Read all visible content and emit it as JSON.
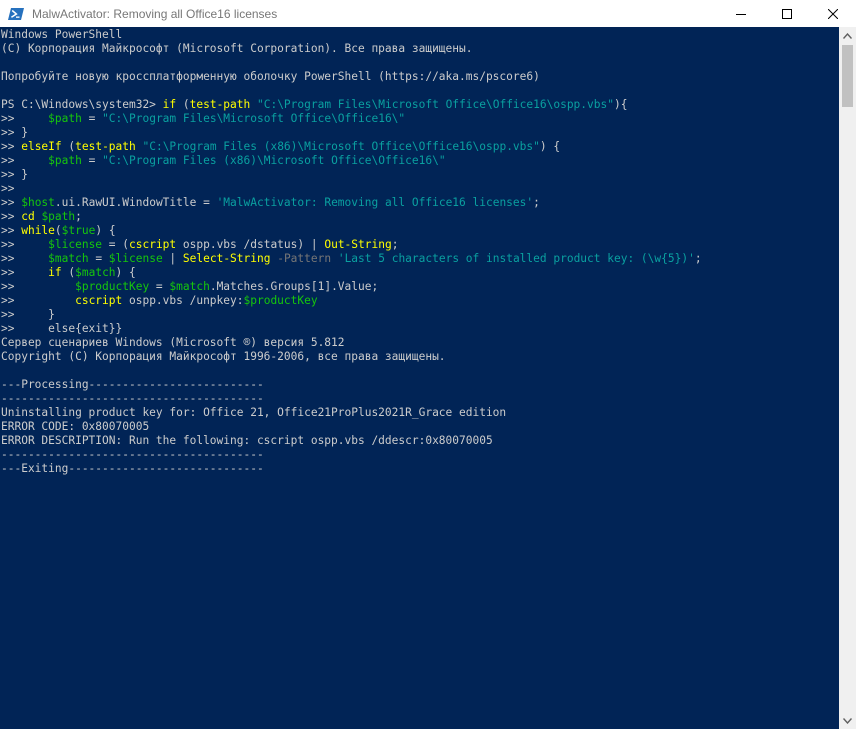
{
  "window": {
    "title": "MalwActivator: Removing all Office16 licenses",
    "controls": {
      "minimize": "minimize",
      "maximize": "maximize",
      "close": "close"
    }
  },
  "icons": {
    "app": "powershell-icon",
    "scroll_up": "chevron-up-icon",
    "scroll_down": "chevron-down-icon"
  },
  "colors": {
    "background": "#012456",
    "text": "#cccccc",
    "command": "#ffff00",
    "variable": "#13a10e",
    "string": "#0aa0a0",
    "operator": "#767676"
  },
  "console": {
    "lines": [
      [
        [
          "w",
          "Windows PowerShell"
        ]
      ],
      [
        [
          "w",
          "(C) Корпорация Майкрософт (Microsoft Corporation). Все права защищены."
        ]
      ],
      [
        [
          "w",
          ""
        ]
      ],
      [
        [
          "w",
          "Попробуйте новую кроссплатформенную оболочку PowerShell (https://aka.ms/pscore6)"
        ]
      ],
      [
        [
          "w",
          ""
        ]
      ],
      [
        [
          "w",
          "PS C:\\Windows\\system32> "
        ],
        [
          "y",
          "if "
        ],
        [
          "w",
          "("
        ],
        [
          "y",
          "test-path "
        ],
        [
          "s",
          "\"C:\\Program Files\\Microsoft Office\\Office16\\ospp.vbs\""
        ],
        [
          "w",
          "){"
        ]
      ],
      [
        [
          "w",
          ">>     "
        ],
        [
          "v",
          "$path"
        ],
        [
          "w",
          " = "
        ],
        [
          "s",
          "\"C:\\Program Files\\Microsoft Office\\Office16\\\""
        ]
      ],
      [
        [
          "w",
          ">> }"
        ]
      ],
      [
        [
          "w",
          ">> "
        ],
        [
          "y",
          "elseIf "
        ],
        [
          "w",
          "("
        ],
        [
          "y",
          "test-path "
        ],
        [
          "s",
          "\"C:\\Program Files (x86)\\Microsoft Office\\Office16\\ospp.vbs\""
        ],
        [
          "w",
          ") {"
        ]
      ],
      [
        [
          "w",
          ">>     "
        ],
        [
          "v",
          "$path"
        ],
        [
          "w",
          " = "
        ],
        [
          "s",
          "\"C:\\Program Files (x86)\\Microsoft Office\\Office16\\\""
        ]
      ],
      [
        [
          "w",
          ">> }"
        ]
      ],
      [
        [
          "w",
          ">>"
        ]
      ],
      [
        [
          "w",
          ">> "
        ],
        [
          "v",
          "$host"
        ],
        [
          "w",
          ".ui.RawUI.WindowTitle = "
        ],
        [
          "s",
          "'MalwActivator: Removing all Office16 licenses'"
        ],
        [
          "w",
          ";"
        ]
      ],
      [
        [
          "w",
          ">> "
        ],
        [
          "y",
          "cd "
        ],
        [
          "v",
          "$path"
        ],
        [
          "w",
          ";"
        ]
      ],
      [
        [
          "w",
          ">> "
        ],
        [
          "y",
          "while"
        ],
        [
          "w",
          "("
        ],
        [
          "v",
          "$true"
        ],
        [
          "w",
          ") {"
        ]
      ],
      [
        [
          "w",
          ">>     "
        ],
        [
          "v",
          "$license"
        ],
        [
          "w",
          " = ("
        ],
        [
          "y",
          "cscript "
        ],
        [
          "w",
          "ospp.vbs /dstatus) | "
        ],
        [
          "y",
          "Out-String"
        ],
        [
          "w",
          ";"
        ]
      ],
      [
        [
          "w",
          ">>     "
        ],
        [
          "v",
          "$match"
        ],
        [
          "w",
          " = "
        ],
        [
          "v",
          "$license"
        ],
        [
          "w",
          " | "
        ],
        [
          "y",
          "Select-String "
        ],
        [
          "gray",
          "-Pattern "
        ],
        [
          "s",
          "'Last 5 characters of installed product key: (\\w{5})'"
        ],
        [
          "w",
          ";"
        ]
      ],
      [
        [
          "w",
          ">>     "
        ],
        [
          "y",
          "if "
        ],
        [
          "w",
          "("
        ],
        [
          "v",
          "$match"
        ],
        [
          "w",
          ") {"
        ]
      ],
      [
        [
          "w",
          ">>         "
        ],
        [
          "v",
          "$productKey"
        ],
        [
          "w",
          " = "
        ],
        [
          "v",
          "$match"
        ],
        [
          "w",
          ".Matches.Groups[1].Value;"
        ]
      ],
      [
        [
          "w",
          ">>         "
        ],
        [
          "y",
          "cscript "
        ],
        [
          "w",
          "ospp.vbs /unpkey:"
        ],
        [
          "v",
          "$productKey"
        ]
      ],
      [
        [
          "w",
          ">>     }"
        ]
      ],
      [
        [
          "w",
          ">>     else{exit}}"
        ]
      ],
      [
        [
          "w",
          "Сервер сценариев Windows (Microsoft ®) версия 5.812"
        ]
      ],
      [
        [
          "w",
          "Copyright (C) Корпорация Майкрософт 1996-2006, все права защищены."
        ]
      ],
      [
        [
          "w",
          ""
        ]
      ],
      [
        [
          "w",
          "---Processing--------------------------"
        ]
      ],
      [
        [
          "w",
          "---------------------------------------"
        ]
      ],
      [
        [
          "w",
          "Uninstalling product key for: Office 21, Office21ProPlus2021R_Grace edition"
        ]
      ],
      [
        [
          "w",
          "ERROR CODE: 0x80070005"
        ]
      ],
      [
        [
          "w",
          "ERROR DESCRIPTION: Run the following: cscript ospp.vbs /ddescr:0x80070005"
        ]
      ],
      [
        [
          "w",
          "---------------------------------------"
        ]
      ],
      [
        [
          "w",
          "---Exiting-----------------------------"
        ]
      ]
    ]
  }
}
